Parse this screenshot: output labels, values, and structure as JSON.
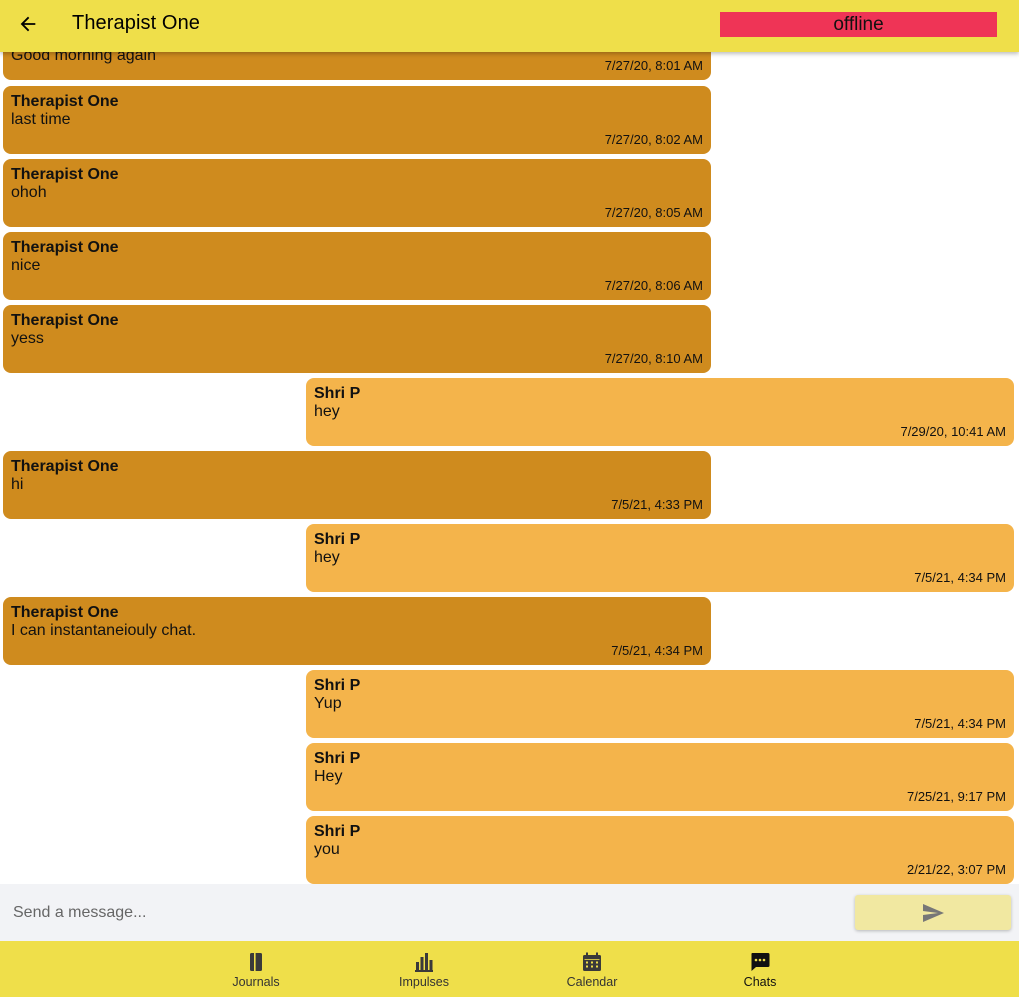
{
  "header": {
    "title": "Therapist One",
    "status": "offline"
  },
  "messages": [
    {
      "sender": "",
      "text": "Good morning again",
      "time": "7/27/20, 8:01 AM",
      "side": "theirs"
    },
    {
      "sender": "Therapist One",
      "text": "last time",
      "time": "7/27/20, 8:02 AM",
      "side": "theirs"
    },
    {
      "sender": "Therapist One",
      "text": "ohoh",
      "time": "7/27/20, 8:05 AM",
      "side": "theirs"
    },
    {
      "sender": "Therapist One",
      "text": "nice",
      "time": "7/27/20, 8:06 AM",
      "side": "theirs"
    },
    {
      "sender": "Therapist One",
      "text": "yess",
      "time": "7/27/20, 8:10 AM",
      "side": "theirs"
    },
    {
      "sender": "Shri P",
      "text": "hey",
      "time": "7/29/20, 10:41 AM",
      "side": "mine"
    },
    {
      "sender": "Therapist One",
      "text": "hi",
      "time": "7/5/21, 4:33 PM",
      "side": "theirs"
    },
    {
      "sender": "Shri P",
      "text": "hey",
      "time": "7/5/21, 4:34 PM",
      "side": "mine"
    },
    {
      "sender": "Therapist One",
      "text": "I can instantaneiouly chat.",
      "time": "7/5/21, 4:34 PM",
      "side": "theirs"
    },
    {
      "sender": "Shri P",
      "text": "Yup",
      "time": "7/5/21, 4:34 PM",
      "side": "mine"
    },
    {
      "sender": "Shri P",
      "text": "Hey",
      "time": "7/25/21, 9:17 PM",
      "side": "mine"
    },
    {
      "sender": "Shri P",
      "text": "you",
      "time": "2/21/22, 3:07 PM",
      "side": "mine"
    }
  ],
  "composer": {
    "placeholder": "Send a message..."
  },
  "nav": {
    "items": [
      {
        "label": "Journals",
        "icon": "journal-icon"
      },
      {
        "label": "Impulses",
        "icon": "bar-chart-icon"
      },
      {
        "label": "Calendar",
        "icon": "calendar-icon"
      },
      {
        "label": "Chats",
        "icon": "chat-bubble-icon"
      }
    ],
    "active": "Chats"
  },
  "colors": {
    "header": "#efdf4a",
    "status_offline": "#ef3456",
    "bubble_theirs": "#cf8b1e",
    "bubble_mine": "#f4b44b",
    "send_button": "#f1e8a1"
  }
}
